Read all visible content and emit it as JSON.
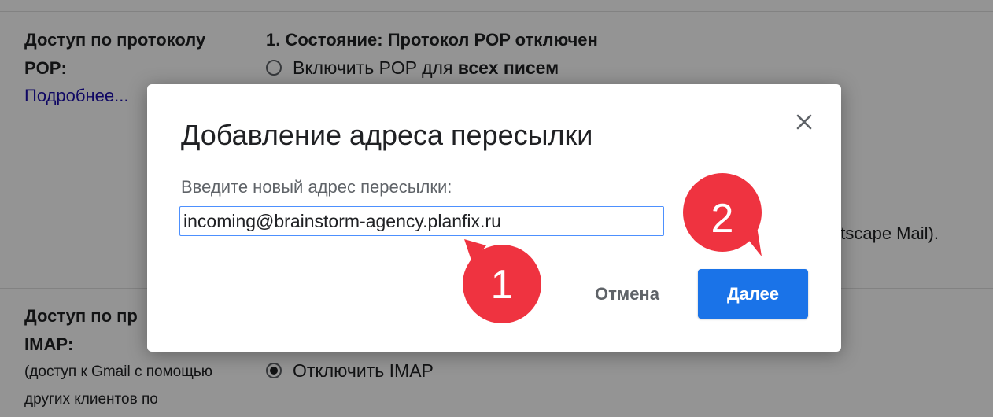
{
  "settings": {
    "pop": {
      "title": "Доступ по протоколу",
      "title2": "POP:",
      "more_link": "Подробнее...",
      "status": "1. Состояние: Протокол POP отключен",
      "option_enable_prefix": "Включить POP для ",
      "option_enable_bold": "всех писем",
      "fragment_right": "etscape Mail)."
    },
    "imap": {
      "title": "Доступ по пр",
      "title2": "IMAP:",
      "desc1": "(доступ к Gmail с помощью",
      "desc2": "других клиентов по",
      "option_disable": "Отключить IMAP"
    }
  },
  "dialog": {
    "title": "Добавление адреса пересылки",
    "field_label": "Введите новый адрес пересылки:",
    "field_value": "incoming@brainstorm-agency.planfix.ru",
    "cancel_label": "Отмена",
    "next_label": "Далее",
    "close_icon": "close-icon"
  },
  "markers": [
    {
      "label": "1"
    },
    {
      "label": "2"
    }
  ],
  "colors": {
    "marker": "#ef3340",
    "primary_button": "#1a73e8",
    "link": "#1a0dab"
  }
}
